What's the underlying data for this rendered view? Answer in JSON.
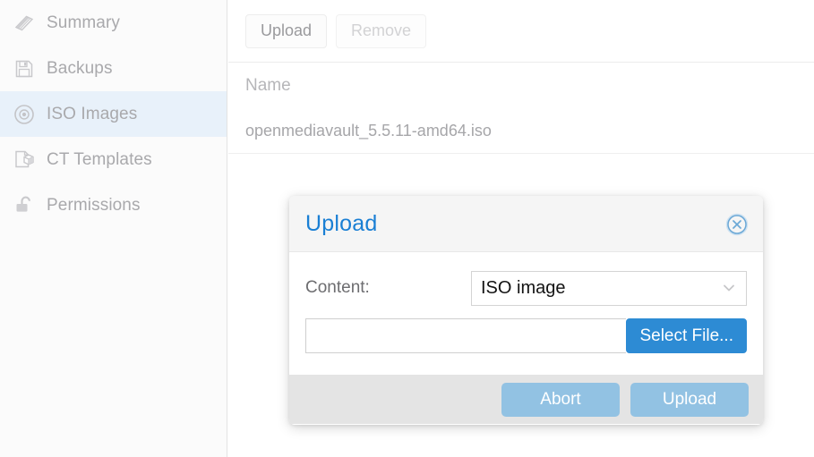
{
  "sidebar": {
    "items": [
      {
        "label": "Summary",
        "icon": "book-icon",
        "selected": false
      },
      {
        "label": "Backups",
        "icon": "floppy-disk-icon",
        "selected": false
      },
      {
        "label": "ISO Images",
        "icon": "disc-icon",
        "selected": true
      },
      {
        "label": "CT Templates",
        "icon": "template-box-icon",
        "selected": false
      },
      {
        "label": "Permissions",
        "icon": "unlock-icon",
        "selected": false
      }
    ]
  },
  "main": {
    "toolbar": {
      "upload_label": "Upload",
      "remove_label": "Remove"
    },
    "grid": {
      "columns": [
        "Name"
      ],
      "rows": [
        {
          "name": "openmediavault_5.5.11-amd64.iso"
        }
      ]
    }
  },
  "dialog": {
    "title": "Upload",
    "close_icon": "close-circle-icon",
    "content_label": "Content:",
    "content_value": "ISO image",
    "content_caret_icon": "chevron-down-icon",
    "file_value": "",
    "file_placeholder": "",
    "select_file_label": "Select File...",
    "abort_label": "Abort",
    "upload_label": "Upload"
  },
  "colors": {
    "accent_blue": "#1a7fd4",
    "button_blue": "#2d8bd4",
    "disabled_blue": "#92c2e3",
    "selected_row": "#e8f1fa",
    "footer_gray": "#e4e4e4",
    "header_gray": "#f5f5f5"
  }
}
